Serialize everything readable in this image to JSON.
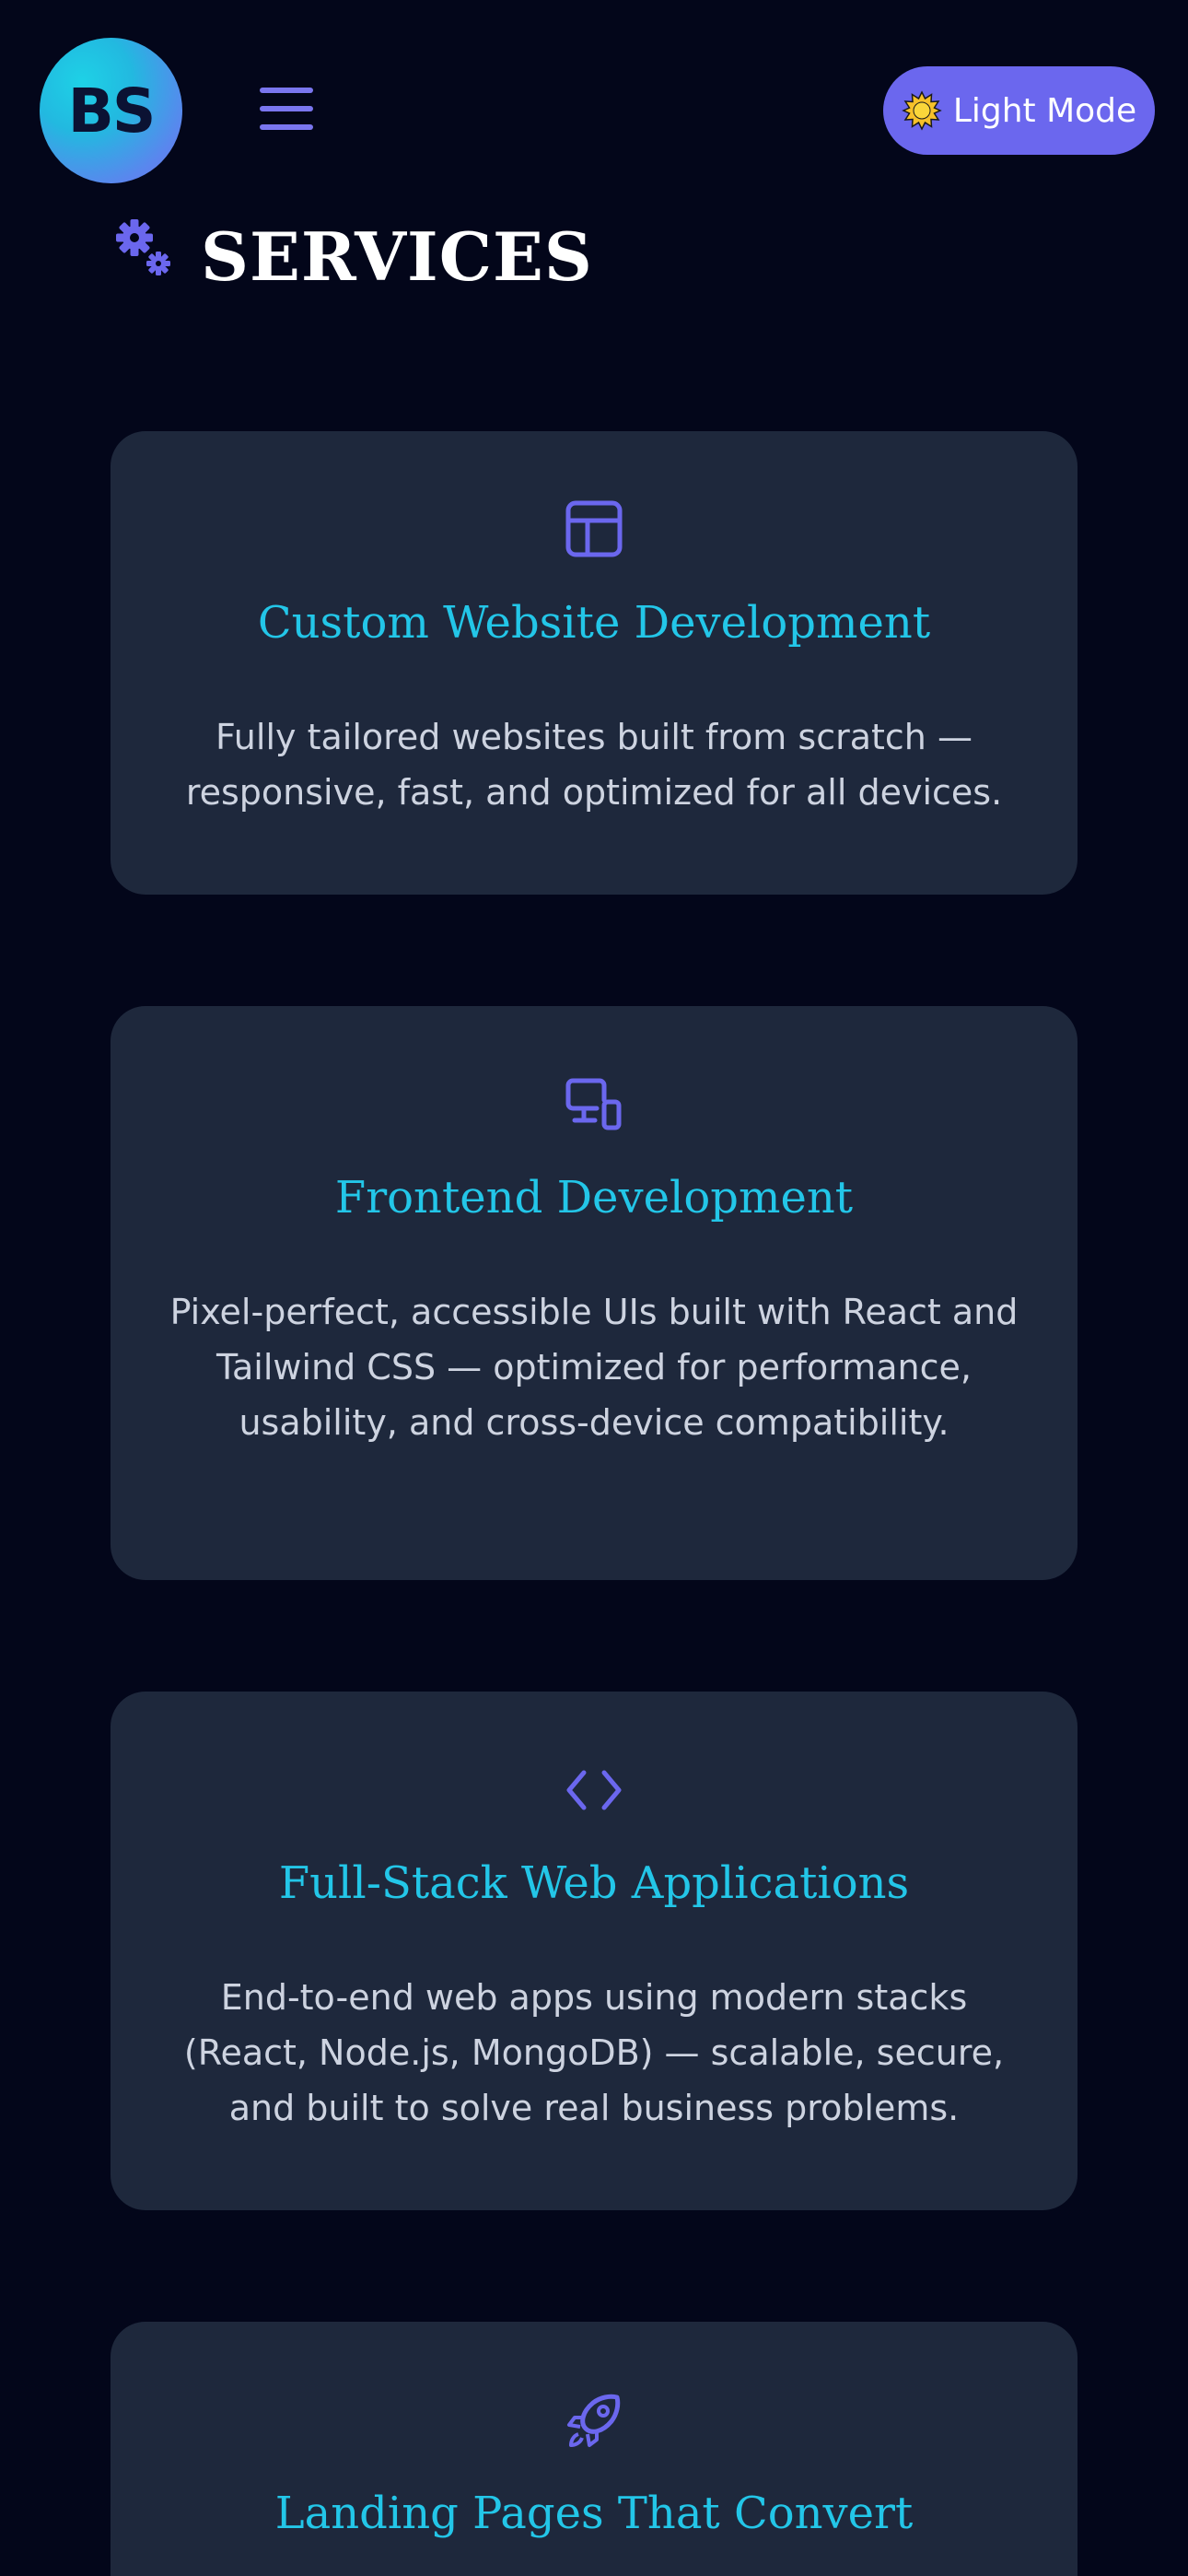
{
  "header": {
    "logo_text": "BS",
    "theme_toggle_label": "Light Mode"
  },
  "section": {
    "title": "SERVICES"
  },
  "services": [
    {
      "icon": "layout-icon",
      "title": "Custom Website Development",
      "description": "Fully tailored websites built from scratch — responsive, fast, and optimized for all devices."
    },
    {
      "icon": "devices-icon",
      "title": "Frontend Development",
      "description": "Pixel-perfect, accessible UIs built with React and Tailwind CSS — optimized for performance, usability, and cross-device compatibility."
    },
    {
      "icon": "code-icon",
      "title": "Full-Stack Web Applications",
      "description": "End-to-end web apps using modern stacks (React, Node.js, MongoDB) — scalable, secure, and built to solve real business problems."
    },
    {
      "icon": "rocket-icon",
      "title": "Landing Pages That Convert",
      "description": ""
    }
  ],
  "colors": {
    "background": "#03061a",
    "card": "#1e283c",
    "accent": "#6b67ee",
    "title": "#23c6e8"
  }
}
